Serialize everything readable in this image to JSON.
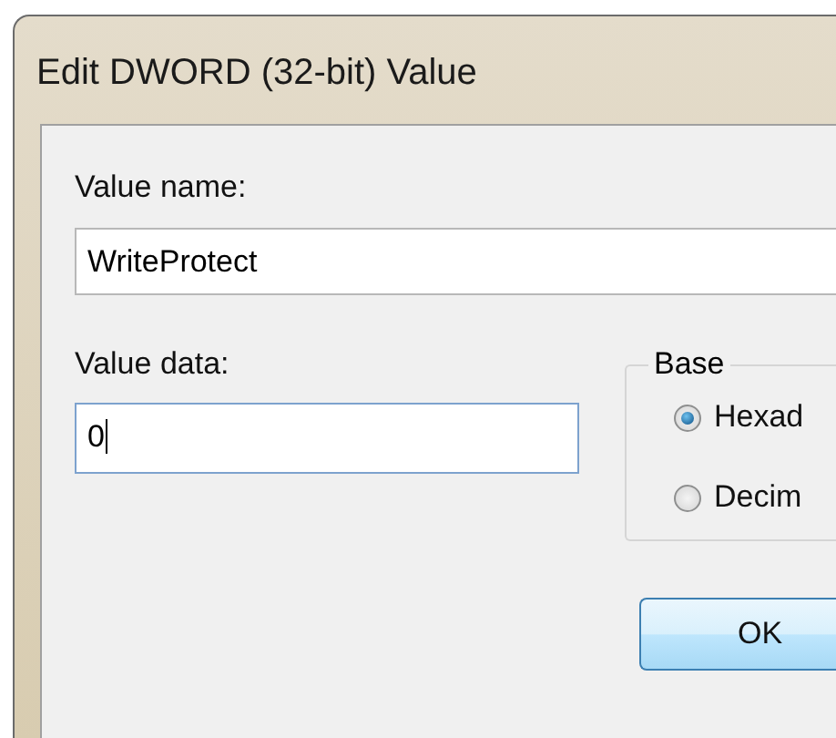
{
  "window": {
    "title": "Edit DWORD (32-bit) Value"
  },
  "value_name": {
    "label": "Value name:",
    "value": "WriteProtect"
  },
  "value_data": {
    "label": "Value data:",
    "value": "0"
  },
  "base": {
    "label": "Base",
    "options": [
      {
        "label": "Hexad",
        "selected": true
      },
      {
        "label": "Decim",
        "selected": false
      }
    ]
  },
  "buttons": [
    "OK"
  ]
}
